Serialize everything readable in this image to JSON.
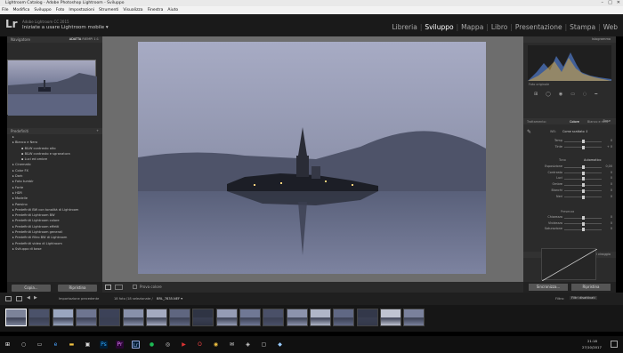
{
  "window": {
    "title": "Lightroom Catalog - Adobe Photoshop Lightroom - Sviluppo",
    "menu": [
      "File",
      "Modifica",
      "Sviluppo",
      "Foto",
      "Impostazioni",
      "Strumenti",
      "Visualizza",
      "Finestra",
      "Aiuto"
    ]
  },
  "identity": {
    "logo": "Lr",
    "line1": "Adobe Lightroom CC 2015",
    "line2": "Iniziate a usare Lightroom mobile ▾"
  },
  "modules": [
    "Libreria",
    "Sviluppo",
    "Mappa",
    "Libro",
    "Presentazione",
    "Stampa",
    "Web"
  ],
  "active_module": "Sviluppo",
  "left_panel": {
    "navigator": {
      "title": "Navigatore",
      "fit": "ADATTA",
      "fill": "RIEMPI",
      "ratio": "1:1"
    },
    "presets_title": "Predefiniti",
    "presets": [
      {
        "label": "",
        "level": 0
      },
      {
        "label": "Bianco e Nero",
        "level": 0
      },
      {
        "label": "B&W contrasto alto",
        "level": 1
      },
      {
        "label": "B&W contrasto e sgranatura",
        "level": 1
      },
      {
        "label": "Luci ed ombre",
        "level": 1
      },
      {
        "label": "Cinematic",
        "level": 0
      },
      {
        "label": "Color FX",
        "level": 0
      },
      {
        "label": "Dark",
        "level": 0
      },
      {
        "label": "Foto tumblr",
        "level": 0
      },
      {
        "label": "Forte",
        "level": 0
      },
      {
        "label": "HDR",
        "level": 0
      },
      {
        "label": "Modelle",
        "level": 0
      },
      {
        "label": "Paesino",
        "level": 0
      },
      {
        "label": "Predefiniti BW con tonalità di Lightroom",
        "level": 0
      },
      {
        "label": "Predefiniti Lightroom BW",
        "level": 0
      },
      {
        "label": "Predefiniti Lightroom colore",
        "level": 0
      },
      {
        "label": "Predefiniti Lightroom effetti",
        "level": 0
      },
      {
        "label": "Predefiniti Lightroom generali",
        "level": 0
      },
      {
        "label": "Predefiniti filtro BW di Lightroom",
        "level": 0
      },
      {
        "label": "Predefiniti video di Lightroom",
        "level": 0
      },
      {
        "label": "Sviluppo di base",
        "level": 0
      }
    ],
    "copy_button": "Copia...",
    "reset_button": "Ripristina"
  },
  "toolbar": {
    "soft_proof": "Prova colore"
  },
  "right_panel": {
    "histogram_title": "Istogramma",
    "original_photo": "Foto originale",
    "basic_title": "Base",
    "treatment_label": "Trattamento:",
    "treatment_color": "Colore",
    "treatment_bw": "Bianco e nero",
    "wb_label": "WB:",
    "wb_value": "Come scattato ↕",
    "sliders_wb": [
      {
        "label": "Temp",
        "value": "0",
        "pos": 0.5
      },
      {
        "label": "Tinte",
        "value": "+ 0",
        "pos": 0.5
      }
    ],
    "tone_label": "Tono",
    "auto_label": "Automatico",
    "sliders_tone": [
      {
        "label": "Esposizione",
        "value": "0,00",
        "pos": 0.5
      },
      {
        "label": "Contrasto",
        "value": "0",
        "pos": 0.5
      },
      {
        "label": "Luci",
        "value": "0",
        "pos": 0.5
      },
      {
        "label": "Ombre",
        "value": "0",
        "pos": 0.5
      },
      {
        "label": "Bianchi",
        "value": "0",
        "pos": 0.5
      },
      {
        "label": "Neri",
        "value": "0",
        "pos": 0.5
      }
    ],
    "presence_label": "Presenza",
    "sliders_presence": [
      {
        "label": "Chiarezza",
        "value": "0",
        "pos": 0.5
      },
      {
        "label": "Vividezza",
        "value": "0",
        "pos": 0.5
      },
      {
        "label": "Saturazione",
        "value": "0",
        "pos": 0.5
      }
    ],
    "curve_title": "Curva di viraggio",
    "sync_button": "Sincronizza...",
    "reset_button": "Ripristina"
  },
  "filmstrip": {
    "source": "Importazione precedente",
    "info": "18 foto /18 selezionate /",
    "filename": "BRL_7835.NEF ▾",
    "filter_label": "Filtro:",
    "filter_value": "Filtri disattivati"
  },
  "taskbar": {
    "time": "21:18",
    "date": "27/10/2017"
  },
  "colors": {
    "chrome_dark": "#2b2b2b",
    "center_bg": "#6d6d6d",
    "active_module": "#ffffff",
    "ps_blue": "#001e36",
    "pr_purple": "#2a0634"
  }
}
